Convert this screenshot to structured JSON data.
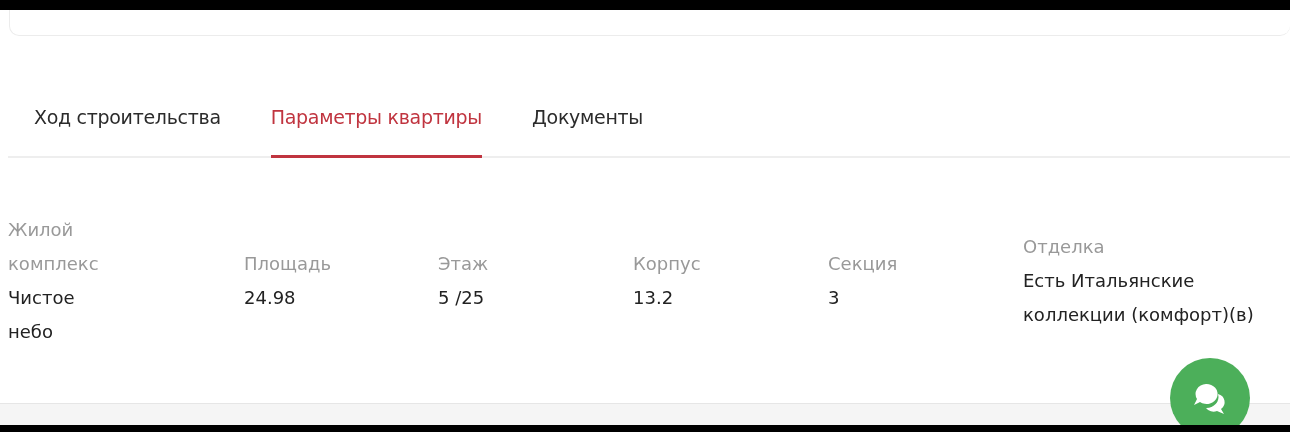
{
  "tabs": [
    {
      "label": "Ход строительства",
      "selected": false
    },
    {
      "label": "Параметры квартиры",
      "selected": true
    },
    {
      "label": "Документы",
      "selected": false
    }
  ],
  "parameters": [
    {
      "label": "Жилой комплекс",
      "value": "Чистое небо"
    },
    {
      "label": "Площадь",
      "value": "24.98"
    },
    {
      "label": "Этаж",
      "value": "5 /25"
    },
    {
      "label": "Корпус",
      "value": "13.2"
    },
    {
      "label": "Секция",
      "value": "3"
    },
    {
      "label": "Отделка",
      "value": "Есть Итальянские коллекции (комфорт)(в)"
    }
  ]
}
